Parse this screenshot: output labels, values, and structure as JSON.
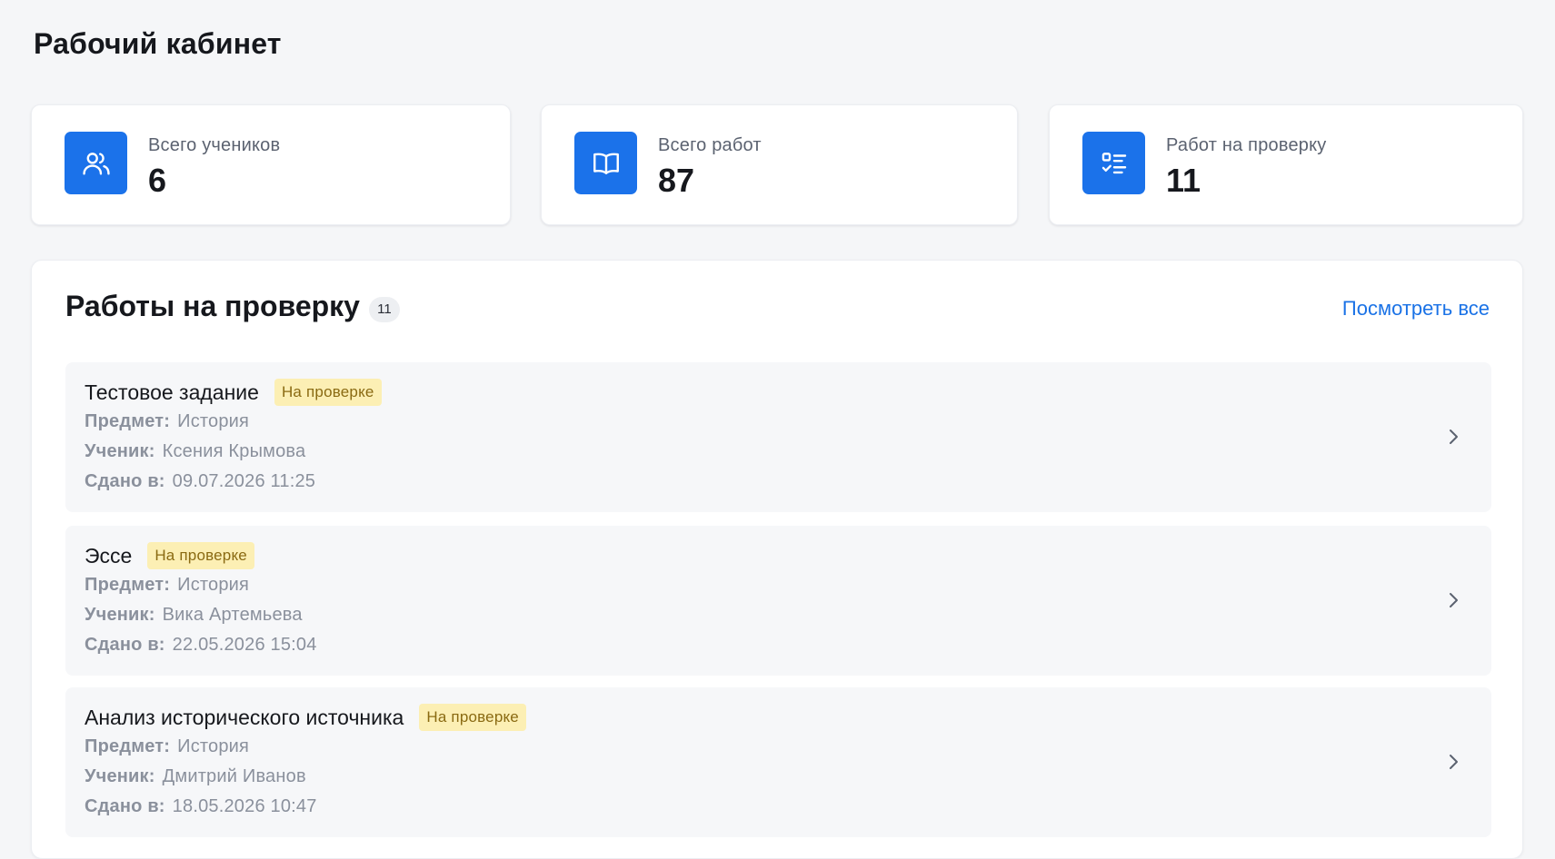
{
  "page": {
    "title": "Рабочий кабинет"
  },
  "stats": [
    {
      "label": "Всего учеников",
      "value": "6",
      "icon": "users-icon"
    },
    {
      "label": "Всего работ",
      "value": "87",
      "icon": "book-open-icon"
    },
    {
      "label": "Работ на проверку",
      "value": "11",
      "icon": "checklist-icon"
    }
  ],
  "colors": {
    "accent": "#1b72ea",
    "status_bg": "#fcefb4",
    "status_text": "#8a6a12",
    "link": "#1a72e6"
  },
  "review": {
    "title": "Работы на проверку",
    "count": "11",
    "view_all": "Посмотреть все",
    "labels": {
      "subject": "Предмет:",
      "student": "Ученик:",
      "submitted": "Сдано в:"
    },
    "items": [
      {
        "title": "Тестовое задание",
        "status": "На проверке",
        "subject": "История",
        "student": "Ксения Крымова",
        "submitted": "09.07.2026 11:25"
      },
      {
        "title": "Эссе",
        "status": "На проверке",
        "subject": "История",
        "student": "Вика Артемьева",
        "submitted": "22.05.2026 15:04"
      },
      {
        "title": "Анализ исторического источника",
        "status": "На проверке",
        "subject": "История",
        "student": "Дмитрий Иванов",
        "submitted": "18.05.2026 10:47"
      }
    ]
  }
}
